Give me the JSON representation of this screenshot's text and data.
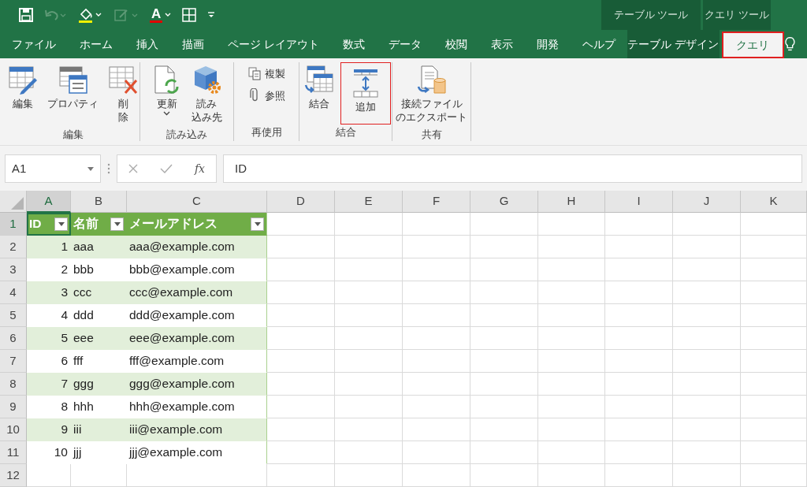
{
  "quick_access": {
    "font_color_label": "A"
  },
  "context_groups": [
    {
      "label": "テーブル ツール"
    },
    {
      "label": "クエリ ツール"
    }
  ],
  "tabs": [
    {
      "label": "ファイル",
      "selected": false,
      "kind": "normal",
      "highlighted": false
    },
    {
      "label": "ホーム",
      "selected": false,
      "kind": "normal",
      "highlighted": false
    },
    {
      "label": "挿入",
      "selected": false,
      "kind": "normal",
      "highlighted": false
    },
    {
      "label": "描画",
      "selected": false,
      "kind": "normal",
      "highlighted": false
    },
    {
      "label": "ページ レイアウト",
      "selected": false,
      "kind": "normal",
      "highlighted": false
    },
    {
      "label": "数式",
      "selected": false,
      "kind": "normal",
      "highlighted": false
    },
    {
      "label": "データ",
      "selected": false,
      "kind": "normal",
      "highlighted": false
    },
    {
      "label": "校閲",
      "selected": false,
      "kind": "normal",
      "highlighted": false
    },
    {
      "label": "表示",
      "selected": false,
      "kind": "normal",
      "highlighted": false
    },
    {
      "label": "開発",
      "selected": false,
      "kind": "normal",
      "highlighted": false
    },
    {
      "label": "ヘルプ",
      "selected": false,
      "kind": "normal",
      "highlighted": false
    },
    {
      "label": "テーブル デザイン",
      "selected": false,
      "kind": "context",
      "highlighted": false
    },
    {
      "label": "クエリ",
      "selected": true,
      "kind": "context",
      "highlighted": true
    }
  ],
  "ribbon_groups": [
    {
      "label": "編集",
      "buttons": [
        {
          "lines": [
            "編集"
          ],
          "kind": "large",
          "highlighted": false
        },
        {
          "lines": [
            "プロパティ"
          ],
          "kind": "large",
          "highlighted": false
        },
        {
          "lines": [
            "削",
            "除"
          ],
          "kind": "large",
          "highlighted": false
        }
      ]
    },
    {
      "label": "読み込み",
      "buttons": [
        {
          "lines": [
            "更新"
          ],
          "kind": "split",
          "highlighted": false
        },
        {
          "lines": [
            "読み",
            "込み先"
          ],
          "kind": "large",
          "highlighted": false
        }
      ]
    },
    {
      "label": "再使用",
      "buttons": [
        {
          "lines": [
            "複製"
          ],
          "kind": "small",
          "highlighted": false
        },
        {
          "lines": [
            "参照"
          ],
          "kind": "small",
          "highlighted": false
        }
      ]
    },
    {
      "label": "結合",
      "buttons": [
        {
          "lines": [
            "結合"
          ],
          "kind": "large",
          "highlighted": false
        },
        {
          "lines": [
            "追加"
          ],
          "kind": "large",
          "highlighted": true
        }
      ]
    },
    {
      "label": "共有",
      "buttons": [
        {
          "lines": [
            "接続ファイル",
            "のエクスポート"
          ],
          "kind": "large",
          "highlighted": false
        }
      ]
    }
  ],
  "name_box": {
    "value": "A1"
  },
  "formula_bar": {
    "function_label": "fx",
    "value": "ID"
  },
  "columns": [
    {
      "label": "A",
      "selected": true
    },
    {
      "label": "B",
      "selected": false
    },
    {
      "label": "C",
      "selected": false
    },
    {
      "label": "D",
      "selected": false
    },
    {
      "label": "E",
      "selected": false
    },
    {
      "label": "F",
      "selected": false
    },
    {
      "label": "G",
      "selected": false
    },
    {
      "label": "H",
      "selected": false
    },
    {
      "label": "I",
      "selected": false
    },
    {
      "label": "J",
      "selected": false
    },
    {
      "label": "K",
      "selected": false
    }
  ],
  "rows": [
    {
      "number": "1",
      "selected": true,
      "kind": "header",
      "cells": [
        "ID",
        "名前",
        "メールアドレス"
      ]
    },
    {
      "number": "2",
      "selected": false,
      "kind": "data",
      "band": true,
      "cells": [
        "1",
        "aaa",
        "aaa@example.com"
      ]
    },
    {
      "number": "3",
      "selected": false,
      "kind": "data",
      "band": false,
      "cells": [
        "2",
        "bbb",
        "bbb@example.com"
      ]
    },
    {
      "number": "4",
      "selected": false,
      "kind": "data",
      "band": true,
      "cells": [
        "3",
        "ccc",
        "ccc@example.com"
      ]
    },
    {
      "number": "5",
      "selected": false,
      "kind": "data",
      "band": false,
      "cells": [
        "4",
        "ddd",
        "ddd@example.com"
      ]
    },
    {
      "number": "6",
      "selected": false,
      "kind": "data",
      "band": true,
      "cells": [
        "5",
        "eee",
        "eee@example.com"
      ]
    },
    {
      "number": "7",
      "selected": false,
      "kind": "data",
      "band": false,
      "cells": [
        "6",
        "fff",
        "fff@example.com"
      ]
    },
    {
      "number": "8",
      "selected": false,
      "kind": "data",
      "band": true,
      "cells": [
        "7",
        "ggg",
        "ggg@example.com"
      ]
    },
    {
      "number": "9",
      "selected": false,
      "kind": "data",
      "band": false,
      "cells": [
        "8",
        "hhh",
        "hhh@example.com"
      ]
    },
    {
      "number": "10",
      "selected": false,
      "kind": "data",
      "band": true,
      "cells": [
        "9",
        "iii",
        "iii@example.com"
      ]
    },
    {
      "number": "11",
      "selected": false,
      "kind": "data",
      "band": false,
      "cells": [
        "10",
        "jjj",
        "jjj@example.com"
      ]
    },
    {
      "number": "12",
      "selected": false,
      "kind": "empty"
    }
  ]
}
